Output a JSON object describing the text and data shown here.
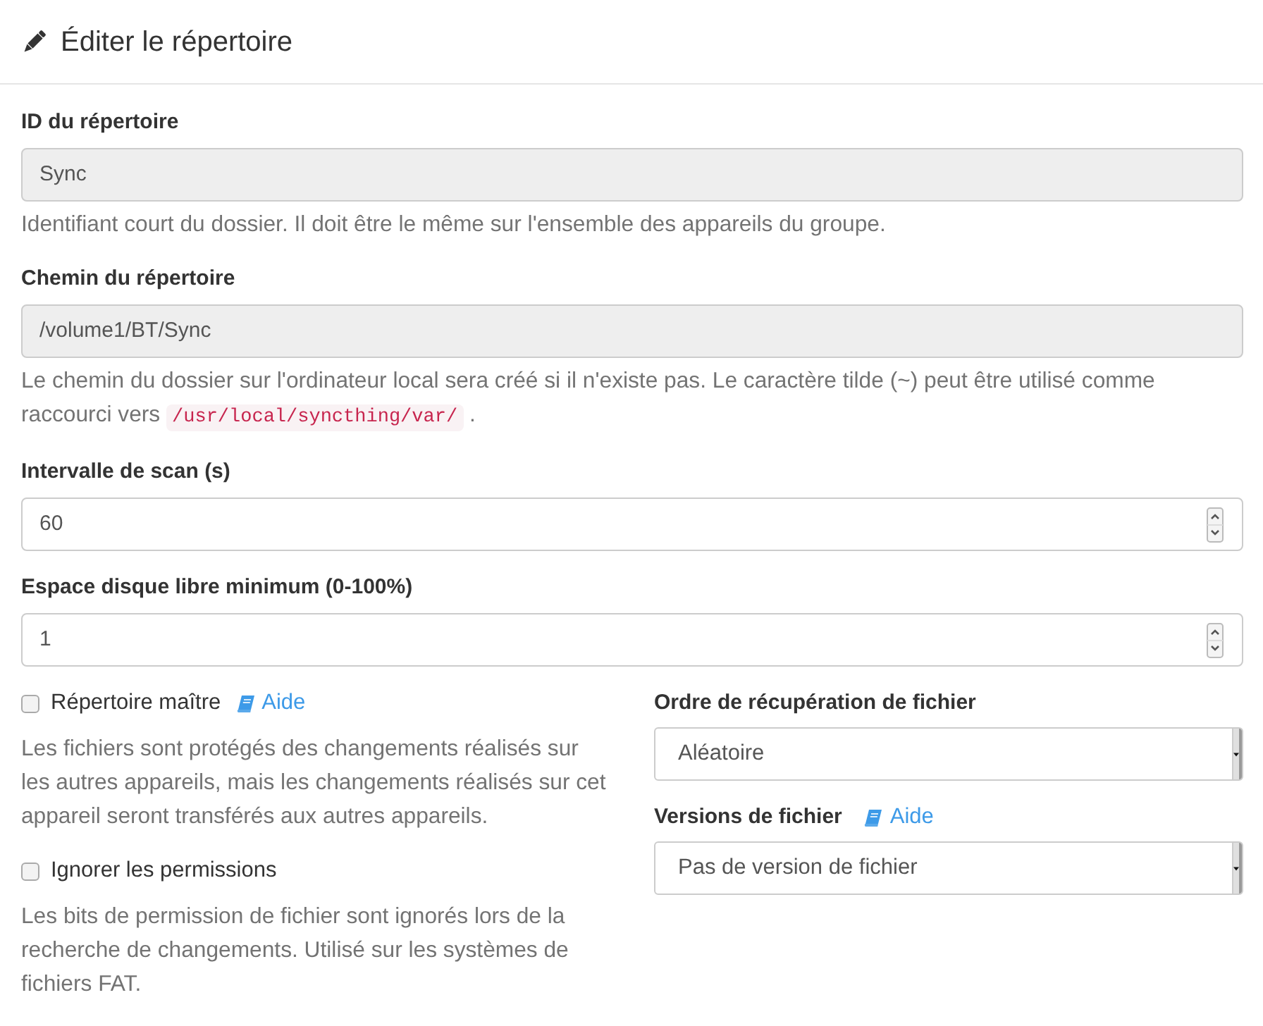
{
  "header": {
    "title": "Éditer le répertoire"
  },
  "fields": [
    {
      "kind": "readonly",
      "label": "ID du répertoire",
      "value": "Sync",
      "help": "Identifiant court du dossier. Il doit être le même sur l'ensemble des appareils du groupe."
    },
    {
      "kind": "readonly",
      "label": "Chemin du répertoire",
      "value": "/volume1/BT/Sync",
      "help": "Le chemin du dossier sur l'ordinateur local sera créé si il n'existe pas. Le caractère tilde (~) peut être utilisé comme raccourci vers",
      "help_code": "/usr/local/syncthing/var/",
      "help_end": "."
    },
    {
      "kind": "number",
      "label": "Intervalle de scan (s)",
      "value": "60"
    },
    {
      "kind": "number",
      "label": "Espace disque libre minimum (0-100%)",
      "value": "1"
    }
  ],
  "options": [
    {
      "label": "Répertoire maître",
      "checked": false,
      "help_link": "Aide",
      "help": "Les fichiers sont protégés des changements réalisés sur les autres appareils, mais les changements réalisés sur cet appareil seront transférés aux autres appareils."
    },
    {
      "label": "Ignorer les permissions",
      "checked": false,
      "help": "Les bits de permission de fichier sont ignorés lors de la recherche de changements. Utilisé sur les systèmes de fichiers FAT."
    }
  ],
  "selects": [
    {
      "label": "Ordre de récupération de fichier",
      "value": "Aléatoire"
    },
    {
      "label": "Versions de fichier",
      "help_link": "Aide",
      "value": "Pas de version de fichier"
    }
  ]
}
